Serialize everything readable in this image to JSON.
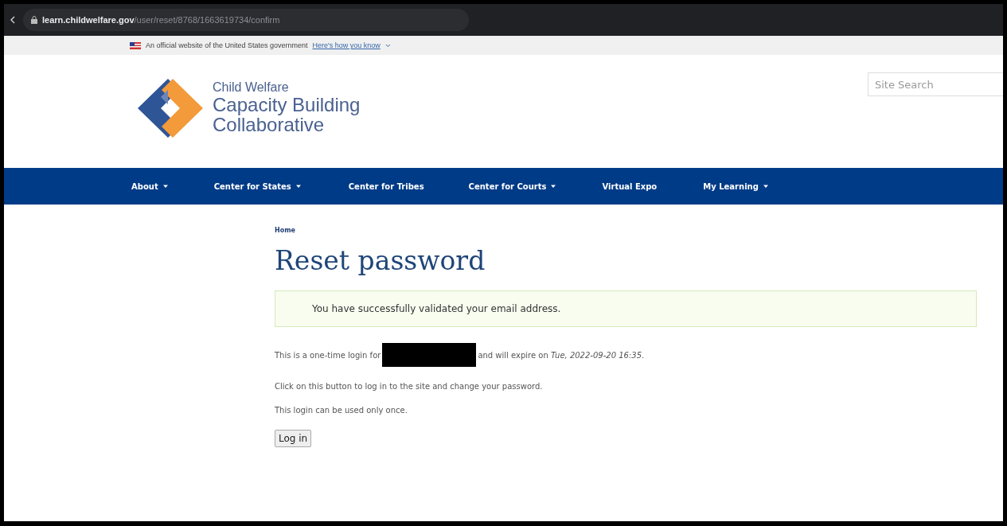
{
  "browser": {
    "url_host": "learn.childwelfare.gov",
    "url_path": "/user/reset/8768/1663619734/confirm"
  },
  "gov_banner": {
    "text": "An official website of the United States government",
    "link": "Here's how you know"
  },
  "logo": {
    "line_1": "Child Welfare",
    "line_2": "Capacity Building",
    "line_3": "Collaborative"
  },
  "search": {
    "placeholder": "Site Search"
  },
  "nav": [
    {
      "label": "About",
      "has_menu": true
    },
    {
      "label": "Center for States",
      "has_menu": true
    },
    {
      "label": "Center for Tribes",
      "has_menu": false
    },
    {
      "label": "Center for Courts",
      "has_menu": true
    },
    {
      "label": "Virtual Expo",
      "has_menu": false
    },
    {
      "label": "My Learning",
      "has_menu": true
    }
  ],
  "breadcrumb": "Home",
  "title": "Reset password",
  "message": "You have successfully validated your email address.",
  "paragraphs": [
    {
      "kind": "redacted",
      "before": "This is a one-time login for",
      "after": "and will expire on *Tue, 2022-09-20 16:35*."
    },
    {
      "kind": "text",
      "text": "Click on this button to log in to the site and change your password."
    },
    {
      "kind": "text",
      "text": "This login can be used only once."
    }
  ],
  "button": "Log in"
}
